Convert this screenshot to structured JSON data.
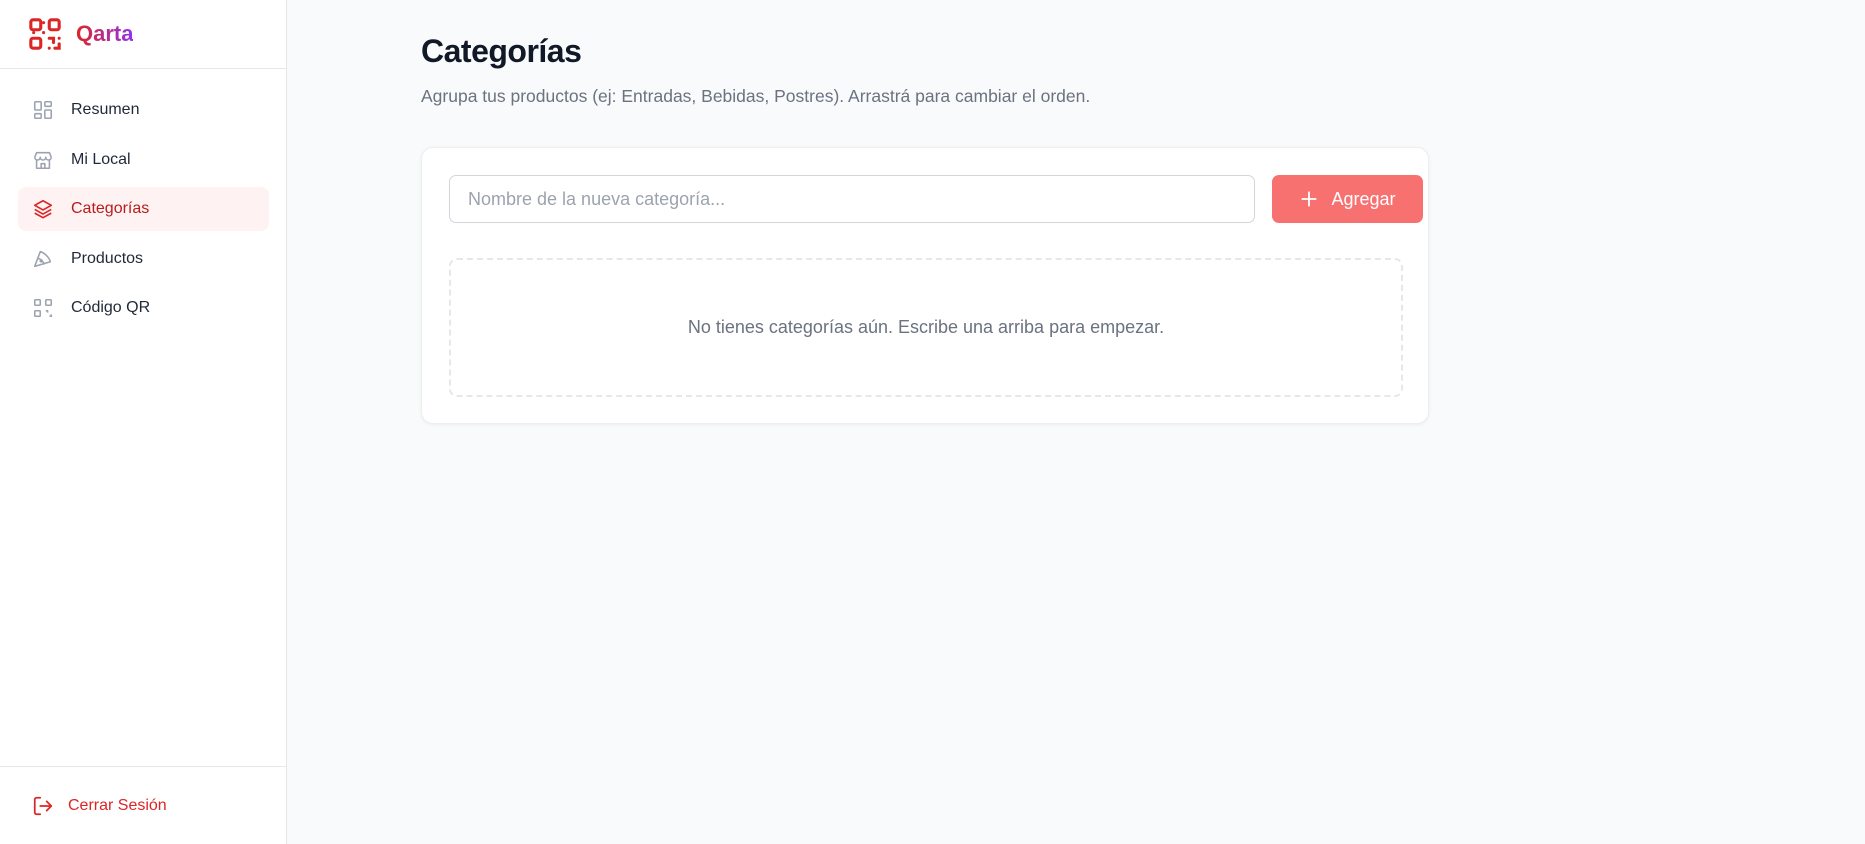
{
  "app": {
    "name": "Qarta",
    "brand_colors": [
      "#dc2626",
      "#9333ea"
    ]
  },
  "sidebar": {
    "items": [
      {
        "label": "Resumen",
        "icon": "dashboard-icon",
        "active": false
      },
      {
        "label": "Mi Local",
        "icon": "store-icon",
        "active": false
      },
      {
        "label": "Categorías",
        "icon": "layers-icon",
        "active": true
      },
      {
        "label": "Productos",
        "icon": "pizza-icon",
        "active": false
      },
      {
        "label": "Código QR",
        "icon": "qr-code-icon",
        "active": false
      }
    ],
    "logout_label": "Cerrar Sesión"
  },
  "page": {
    "title": "Categorías",
    "subtitle": "Agrupa tus productos (ej: Entradas, Bebidas, Postres). Arrastrá para cambiar el orden."
  },
  "form": {
    "input_placeholder": "Nombre de la nueva categoría...",
    "input_value": "",
    "add_label": "Agregar"
  },
  "empty_state": {
    "message": "No tienes categorías aún. Escribe una arriba para empezar."
  },
  "colors": {
    "accent": "#dc2626",
    "button": "#f87171",
    "active_bg": "#fef2f2"
  }
}
